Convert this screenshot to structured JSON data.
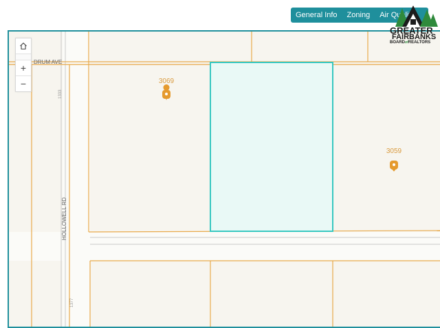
{
  "tabs": [
    "General Info",
    "Zoning",
    "Air Quality"
  ],
  "map": {
    "street_drum": "DRUM AVE",
    "street_hollowell": "HOLLOWELL RD",
    "parcel_left_number": "3069",
    "parcel_right_number": "3059",
    "small_label_top": "1333",
    "small_label_bottom": "1377"
  },
  "logo": {
    "line1": "GREATER",
    "line2": "FAIRBANKS",
    "board": "BOARD",
    "of": "of",
    "realtors": "REALTORS"
  },
  "colors": {
    "accent": "#1f8f9c",
    "parcel_line": "#e8a94a",
    "marker": "#e59a2e",
    "selection_fill": "#e9f9f6",
    "selection_stroke": "#36c7c0"
  }
}
